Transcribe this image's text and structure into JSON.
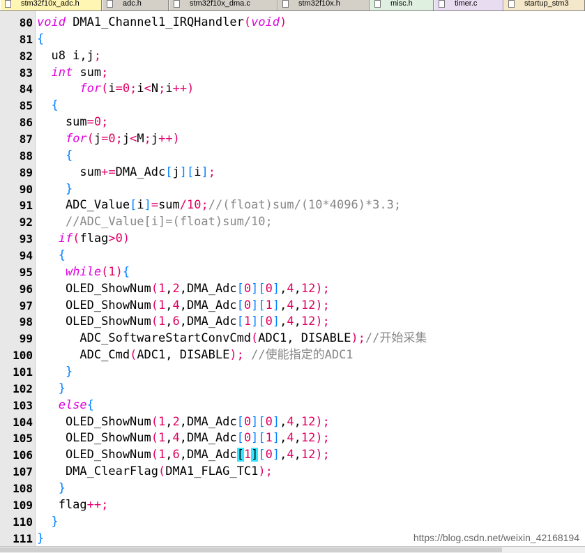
{
  "tabs": [
    {
      "label": "stm32f10x_adc.h",
      "active": true
    },
    {
      "label": "adc.h",
      "active": false
    },
    {
      "label": "stm32f10x_dma.c",
      "active": false
    },
    {
      "label": "stm32f10x.h",
      "active": false
    },
    {
      "label": "misc.h",
      "active": false
    },
    {
      "label": "timer.c",
      "active": false
    },
    {
      "label": "startup_stm3",
      "active": false
    }
  ],
  "editor": {
    "line_numbers": [
      "80",
      "81",
      "82",
      "83",
      "84",
      "85",
      "86",
      "87",
      "88",
      "89",
      "90",
      "91",
      "92",
      "93",
      "94",
      "95",
      "96",
      "97",
      "98",
      "99",
      "100",
      "101",
      "102",
      "103",
      "104",
      "105",
      "106",
      "107",
      "108",
      "109",
      "110",
      "111"
    ],
    "lines": [
      "void DMA1_Channel1_IRQHandler(void)",
      "{",
      "  u8 i,j;",
      "  int sum;",
      "      for(i=0;i<N;i++)",
      "  {",
      "    sum=0;",
      "    for(j=0;j<M;j++)",
      "    {",
      "      sum+=DMA_Adc[j][i];",
      "    }",
      "    ADC_Value[i]=sum/10;//(float)sum/(10*4096)*3.3;",
      "    //ADC_Value[i]=(float)sum/10;",
      "   if(flag>0)",
      "   {",
      "    while(1){",
      "    OLED_ShowNum(1,2,DMA_Adc[0][0],4,12);",
      "    OLED_ShowNum(1,4,DMA_Adc[0][1],4,12);",
      "    OLED_ShowNum(1,6,DMA_Adc[1][0],4,12);",
      "      ADC_SoftwareStartConvCmd(ADC1, DISABLE);//开始采集",
      "      ADC_Cmd(ADC1, DISABLE); //使能指定的ADC1",
      "    }",
      "   }",
      "   else{",
      "    OLED_ShowNum(1,2,DMA_Adc[0][0],4,12);",
      "    OLED_ShowNum(1,4,DMA_Adc[0][1],4,12);",
      "    OLED_ShowNum(1,6,DMA_Adc[1][0],4,12);",
      "    DMA_ClearFlag(DMA1_FLAG_TC1);",
      "   }",
      "   flag++;",
      "  }",
      "}"
    ],
    "highlighted_brackets": {
      "line": "106",
      "chars": [
        "[",
        "]"
      ]
    }
  },
  "watermark": "https://blog.csdn.net/weixin_42168194",
  "colors": {
    "keyword": "#e000e0",
    "operator": "#e0006e",
    "number": "#e00060",
    "bracket": "#0080ff",
    "comment": "#888888",
    "bracket_highlight": "#33e6ff",
    "active_tab": "#fff6b3",
    "gutter": "#e8e8e8"
  }
}
